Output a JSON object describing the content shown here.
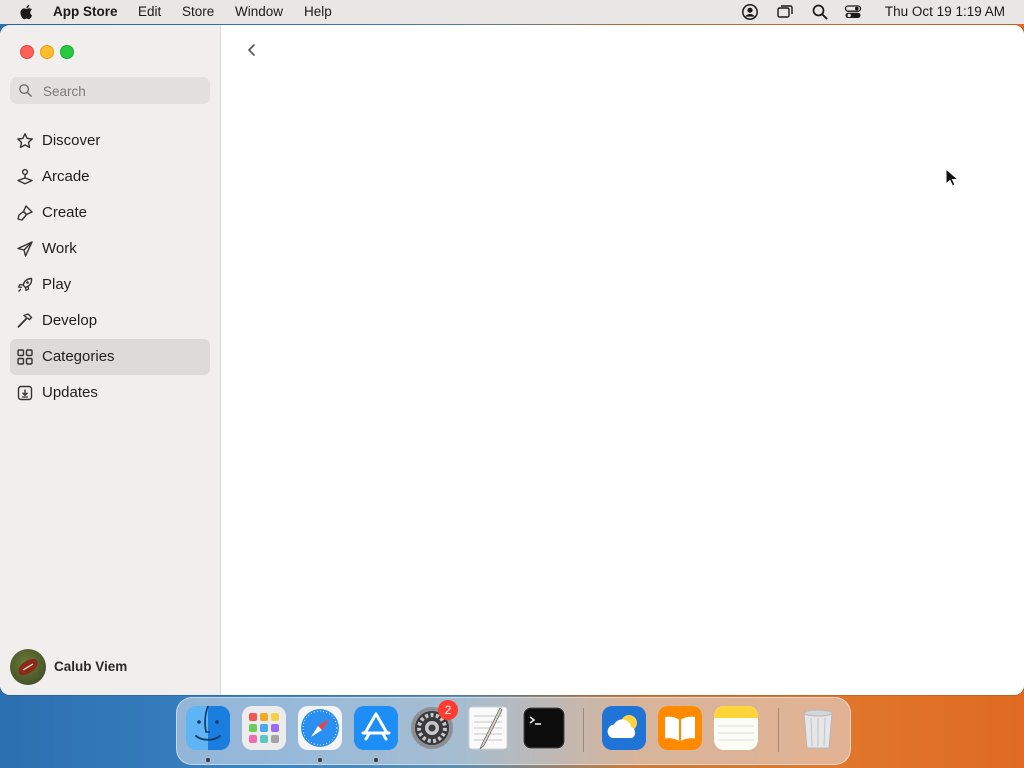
{
  "menubar": {
    "app_name": "App Store",
    "menus": [
      "Edit",
      "Store",
      "Window",
      "Help"
    ],
    "clock": "Thu Oct 19  1:19 AM",
    "status_icons": [
      "user-account-icon",
      "screen-mirroring-icon",
      "spotlight-search-icon",
      "control-center-icon"
    ]
  },
  "sidebar": {
    "search_placeholder": "Search",
    "items": [
      {
        "label": "Discover",
        "icon": "star-icon"
      },
      {
        "label": "Arcade",
        "icon": "joystick-icon"
      },
      {
        "label": "Create",
        "icon": "brush-icon"
      },
      {
        "label": "Work",
        "icon": "paper-plane-icon"
      },
      {
        "label": "Play",
        "icon": "rocket-icon"
      },
      {
        "label": "Develop",
        "icon": "hammer-icon"
      },
      {
        "label": "Categories",
        "icon": "grid-icon"
      },
      {
        "label": "Updates",
        "icon": "download-icon"
      }
    ],
    "selected": "Categories",
    "profile": {
      "name": "Calub Viem"
    }
  },
  "dock": {
    "apps": [
      {
        "name": "Finder",
        "running": true
      },
      {
        "name": "Launchpad",
        "running": false
      },
      {
        "name": "Safari",
        "running": true
      },
      {
        "name": "App Store",
        "running": true
      },
      {
        "name": "System Settings",
        "running": false,
        "badge": "2"
      },
      {
        "name": "TextEdit",
        "running": false
      },
      {
        "name": "Terminal",
        "running": false
      },
      {
        "name": "Weather",
        "running": false
      },
      {
        "name": "Books",
        "running": false
      },
      {
        "name": "Notes",
        "running": false
      },
      {
        "name": "Trash",
        "running": false
      }
    ]
  },
  "colors": {
    "selection": "#dcdbda",
    "sidebar_bg": "#f0efee",
    "close": "#fe5f57",
    "minimize": "#febc2e",
    "maximize": "#28c840",
    "badge": "#ff3b30"
  }
}
